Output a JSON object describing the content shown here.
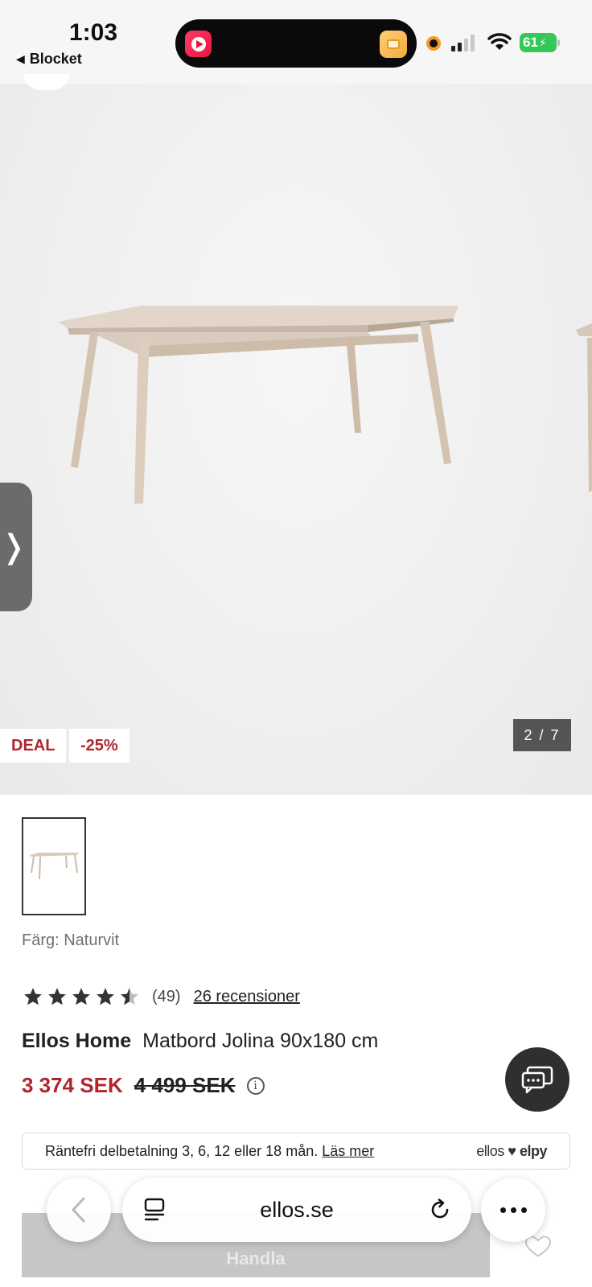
{
  "status_bar": {
    "time": "1:03",
    "back_app": "Blocket",
    "battery": "61"
  },
  "gallery": {
    "deal_badge": "DEAL",
    "discount_badge": "-25%",
    "pager": "2 / 7"
  },
  "product": {
    "color_label": "Färg: Naturvit",
    "rating": 4.5,
    "rating_count": "(49)",
    "reviews_link": "26 recensioner",
    "brand": "Ellos Home",
    "name": "Matbord Jolina 90x180 cm",
    "price_now": "3 374 SEK",
    "price_old": "4 499 SEK",
    "price_now_color": "#b0262e"
  },
  "finance": {
    "text": "Räntefri delbetalning 3, 6, 12 eller 18 mån.",
    "link": "Läs mer",
    "partner_a": "ellos",
    "partner_b": "elpy"
  },
  "buy": {
    "label": "Handla"
  },
  "browser": {
    "url": "ellos.se"
  },
  "icons": {
    "back": "chevron-left-icon",
    "tabs": "tab-overview-icon",
    "reload": "reload-icon",
    "more": "more-dots-icon",
    "chat": "chat-icon",
    "wishlist": "heart-icon",
    "info": "info-icon",
    "next_image": "chevron-right-icon"
  }
}
